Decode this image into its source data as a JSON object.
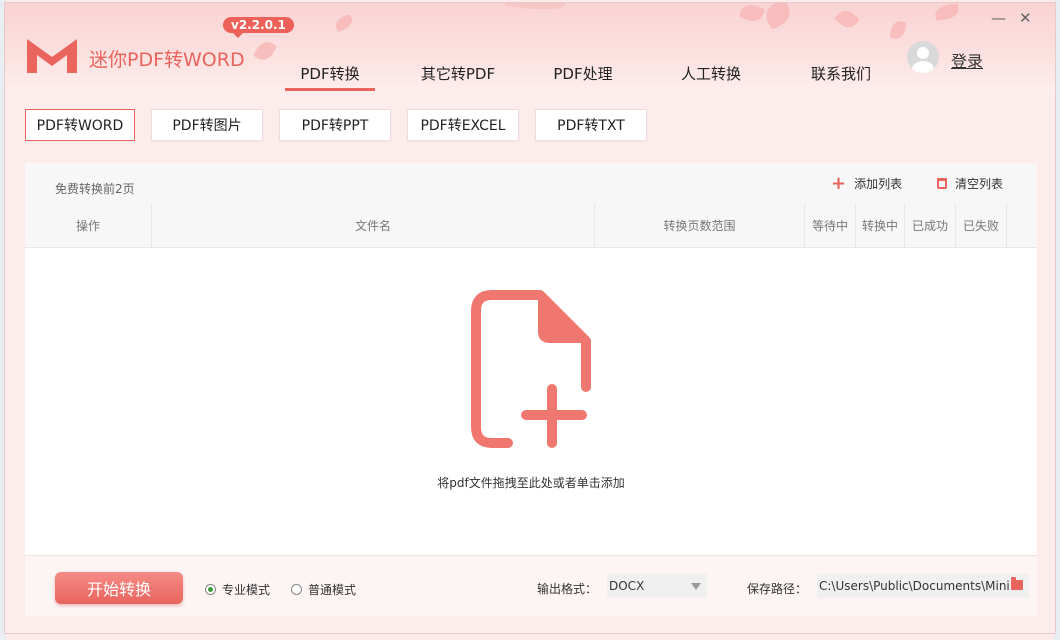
{
  "app": {
    "title": "迷你PDF转WORD",
    "version": "v2.2.0.1"
  },
  "nav": {
    "tabs": [
      {
        "label": "PDF转换"
      },
      {
        "label": "其它转PDF"
      },
      {
        "label": "PDF处理"
      },
      {
        "label": "人工转换"
      },
      {
        "label": "联系我们"
      }
    ],
    "active": "PDF转换"
  },
  "user": {
    "login_label": "登录"
  },
  "window_controls": {
    "minimize": "—",
    "close": "✕"
  },
  "subtabs": [
    {
      "label": "PDF转WORD"
    },
    {
      "label": "PDF转图片"
    },
    {
      "label": "PDF转PPT"
    },
    {
      "label": "PDF转EXCEL"
    },
    {
      "label": "PDF转TXT"
    }
  ],
  "toolbar": {
    "free_note": "免费转换前2页",
    "add_list": "添加列表",
    "clear_list": "清空列表"
  },
  "table": {
    "columns": [
      "操作",
      "文件名",
      "转换页数范围",
      "等待中",
      "转换中",
      "已成功",
      "已失败"
    ]
  },
  "dropzone": {
    "text": "将pdf文件拖拽至此处或者单击添加"
  },
  "bottom": {
    "start_label": "开始转换",
    "mode_pro": "专业模式",
    "mode_normal": "普通模式",
    "output_format_label": "输出格式：",
    "output_format_value": "DOCX",
    "save_path_label": "保存路径：",
    "save_path_value": "C:\\Users\\Public\\Documents\\Mini"
  },
  "colors": {
    "accent": "#e8645d"
  }
}
